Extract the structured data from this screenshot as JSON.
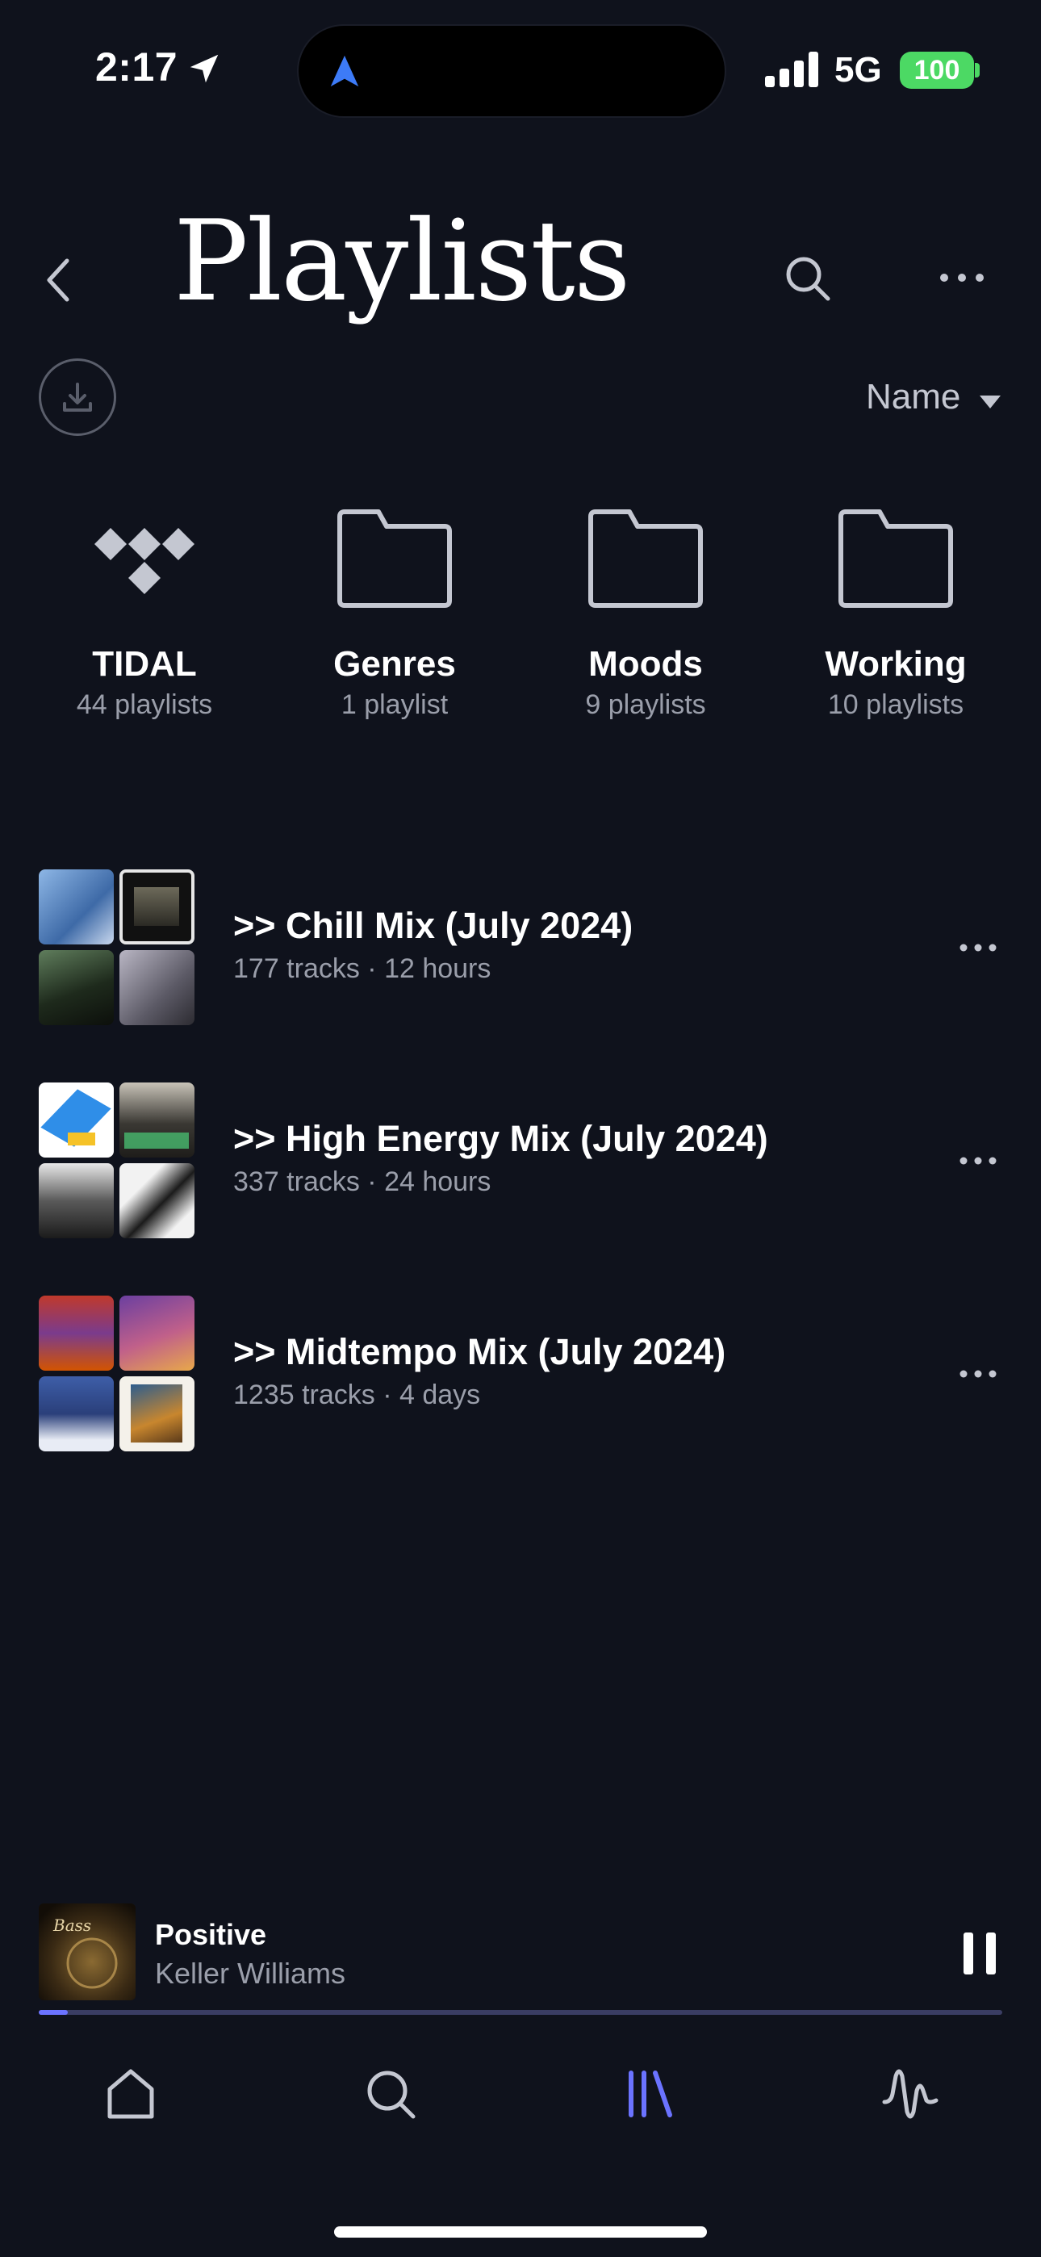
{
  "status": {
    "time": "2:17",
    "network": "5G",
    "battery": "100"
  },
  "header": {
    "title": "Playlists",
    "sort_label": "Name"
  },
  "folders": [
    {
      "name": "TIDAL",
      "count": "44 playlists",
      "icon": "tidal-logo-icon"
    },
    {
      "name": "Genres",
      "count": "1 playlist",
      "icon": "folder-icon"
    },
    {
      "name": "Moods",
      "count": "9 playlists",
      "icon": "folder-icon"
    },
    {
      "name": "Working",
      "count": "10 playlists",
      "icon": "folder-icon"
    }
  ],
  "playlists": [
    {
      "title": ">> Chill Mix (July 2024)",
      "subtitle": "177 tracks · 12 hours"
    },
    {
      "title": ">> High Energy Mix (July 2024)",
      "subtitle": "337 tracks · 24 hours"
    },
    {
      "title": ">> Midtempo Mix (July 2024)",
      "subtitle": "1235 tracks · 4 days"
    }
  ],
  "now_playing": {
    "title": "Positive",
    "artist": "Keller Williams",
    "progress": 0.03
  },
  "tabs": [
    {
      "name": "home",
      "icon": "home-icon",
      "active": false
    },
    {
      "name": "search",
      "icon": "search-icon",
      "active": false
    },
    {
      "name": "library",
      "icon": "library-icon",
      "active": true
    },
    {
      "name": "activity",
      "icon": "waveform-icon",
      "active": false
    }
  ],
  "colors": {
    "background": "#0f121c",
    "accent": "#6b73ff",
    "battery": "#4cd964",
    "secondary_text": "#9a9eaa"
  },
  "mini_art_text": "Bass"
}
